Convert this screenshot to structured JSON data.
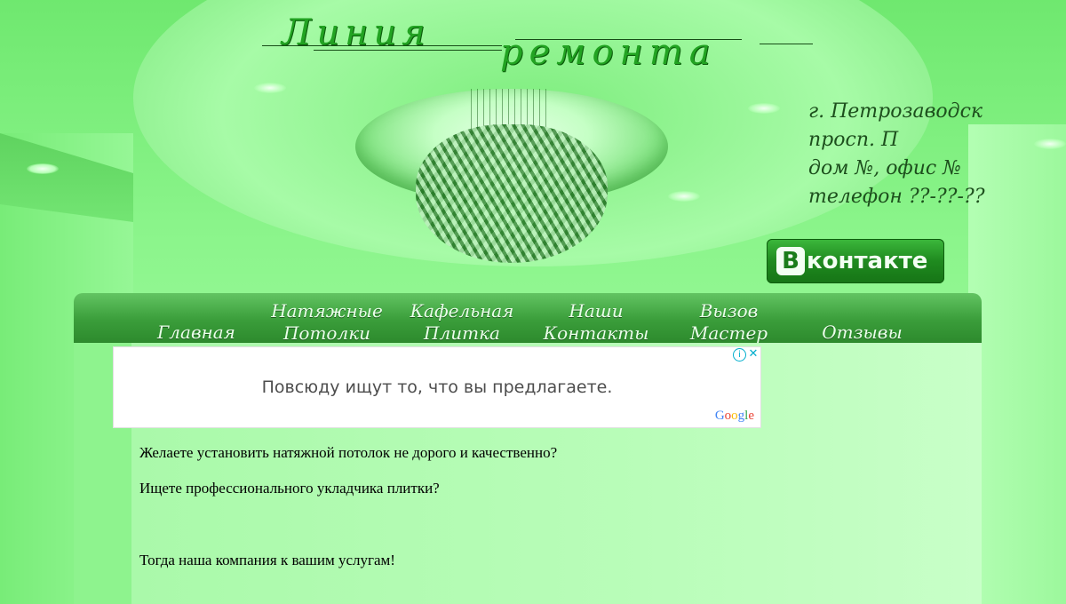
{
  "site": {
    "logo_word1": "Линия",
    "logo_word2": "ремонта"
  },
  "contacts": {
    "city": "г. Петрозаводск",
    "street": "просп. П",
    "house": "дом №, офис №",
    "phone": "телефон ??-??-??"
  },
  "social": {
    "vk_icon_letter": "B",
    "vk_label": "контакте",
    "vk_icon": "vk-logo-icon"
  },
  "nav": {
    "items": [
      {
        "label": "Главная"
      },
      {
        "label": "Натяжные\nПотолки"
      },
      {
        "label": "Кафельная\nПлитка"
      },
      {
        "label": "Наши\nКонтакты"
      },
      {
        "label": "Вызов\nМастер"
      },
      {
        "label": "Отзывы"
      }
    ]
  },
  "ad": {
    "text": "Повсюду ищут то, что вы предлагаете.",
    "info_icon": "info-icon",
    "close_icon": "close-icon",
    "brand": "Google"
  },
  "content": {
    "paragraphs": [
      "Желаете установить натяжной потолок не дорого и качественно?",
      "Ищете профессионального укладчика плитки?",
      "Тогда наша компания к вашим услугам!"
    ]
  },
  "colors": {
    "background": "#8af58a",
    "nav_bar": "#3a9d3a",
    "logo_text": "#22a322",
    "address_text": "#1d4f1d"
  }
}
